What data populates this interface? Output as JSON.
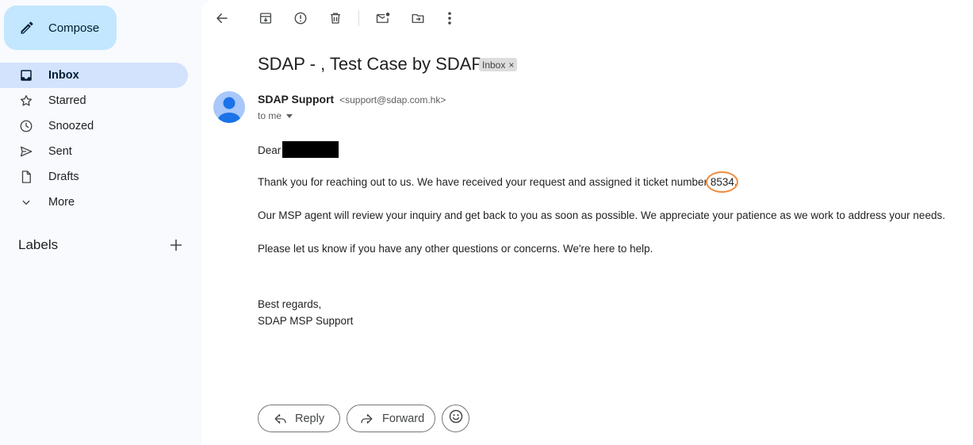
{
  "sidebar": {
    "compose_label": "Compose",
    "items": [
      {
        "label": "Inbox",
        "icon": "inbox-icon",
        "active": true
      },
      {
        "label": "Starred",
        "icon": "star-icon"
      },
      {
        "label": "Snoozed",
        "icon": "clock-icon"
      },
      {
        "label": "Sent",
        "icon": "send-icon"
      },
      {
        "label": "Drafts",
        "icon": "file-icon"
      },
      {
        "label": "More",
        "icon": "chevron-down-icon"
      }
    ],
    "labels_title": "Labels"
  },
  "toolbar": {
    "icons": [
      "back-arrow-icon",
      "archive-icon",
      "report-spam-icon",
      "delete-icon",
      "mark-unread-icon",
      "move-to-icon",
      "more-vert-icon"
    ]
  },
  "email": {
    "subject": "SDAP - , Test Case by SDAP",
    "chip": "Inbox",
    "chip_close": "×",
    "sender_name": "SDAP Support",
    "sender_email": "<support@sdap.com.hk>",
    "to_line": "to me",
    "greeting": "Dear",
    "line1_before": "Thank you for reaching out to us. We have received your request and assigned it ticket number ",
    "ticket_number": "8534",
    "line1_after": ".",
    "line2": "Our MSP agent will review your inquiry and get back to you as soon as possible. We appreciate your patience as we work to address your needs.",
    "line3": "Please let us know if you have any other questions or concerns. We're here to help.",
    "closing": "Best regards,",
    "signature": "SDAP MSP Support"
  },
  "actions": {
    "reply_label": "Reply",
    "forward_label": "Forward"
  },
  "colors": {
    "compose_bg": "#c2e7ff",
    "active_nav_bg": "#d3e3fd",
    "highlight_ring": "#f08a3c",
    "avatar_bg": "#a8c7fa"
  }
}
